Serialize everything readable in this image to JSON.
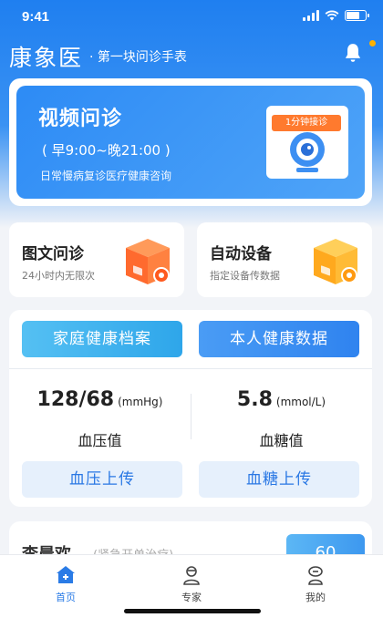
{
  "status_bar": {
    "time": "9:41"
  },
  "header": {
    "logo": "康象医",
    "slogan": "· 第一块问诊手表"
  },
  "video_consult": {
    "title": "视频问诊",
    "hours": "( 早9:00~晚21:00 )",
    "desc": "日常慢病复诊医疗健康咨询",
    "badge": "1分钟接诊"
  },
  "image_consult": {
    "title": "图文问诊",
    "sub": "24小时内无限次"
  },
  "auto_device": {
    "title": "自动设备",
    "sub": "指定设备传数据"
  },
  "health": {
    "family_archive_label": "家庭健康档案",
    "personal_data_label": "本人健康数据",
    "blood_pressure": {
      "value": "128/68",
      "unit": "(mmHg)",
      "label": "血压值",
      "upload_label": "血压上传"
    },
    "blood_sugar": {
      "value": "5.8",
      "unit": "(mmol/L)",
      "label": "血糖值",
      "upload_label": "血糖上传"
    }
  },
  "next_card": {
    "name": "李晨欢",
    "note": "(紧急开单治疗)",
    "button": "60"
  },
  "tabbar": {
    "items": [
      {
        "label": "首页"
      },
      {
        "label": "专家"
      },
      {
        "label": "我的"
      }
    ]
  },
  "colors": {
    "primary": "#2a7be6",
    "accent": "#ff7a2e"
  }
}
